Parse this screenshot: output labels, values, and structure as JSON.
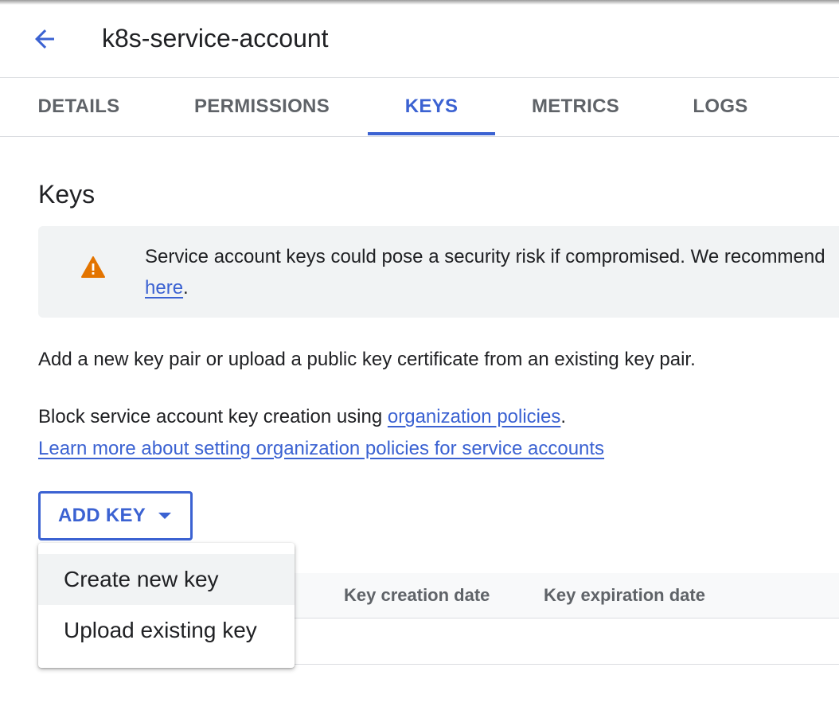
{
  "header": {
    "title": "k8s-service-account",
    "back_icon": "arrow-back-icon"
  },
  "tabs": [
    {
      "label": "DETAILS",
      "active": false
    },
    {
      "label": "PERMISSIONS",
      "active": false
    },
    {
      "label": "KEYS",
      "active": true
    },
    {
      "label": "METRICS",
      "active": false
    },
    {
      "label": "LOGS",
      "active": false
    }
  ],
  "keys_section": {
    "title": "Keys",
    "warning": {
      "icon": "warning-icon",
      "text": "Service account keys could pose a security risk if compromised. We recommend",
      "link_text": "here",
      "trailing": "."
    },
    "description": "Add a new key pair or upload a public key certificate from an existing key pair.",
    "block_text": "Block service account key creation using ",
    "block_link": "organization policies",
    "block_trailing": ".",
    "learn_more_link": "Learn more about setting organization policies for service accounts",
    "add_key_label": "ADD KEY"
  },
  "dropdown_menu": {
    "items": [
      {
        "label": "Create new key",
        "highlighted": true
      },
      {
        "label": "Upload existing key",
        "highlighted": false
      }
    ]
  },
  "table": {
    "columns": [
      "Key creation date",
      "Key expiration date"
    ]
  },
  "colors": {
    "accent": "#3b62d2",
    "warning": "#e37400",
    "text": "#202124",
    "secondary_text": "#5f6368"
  }
}
